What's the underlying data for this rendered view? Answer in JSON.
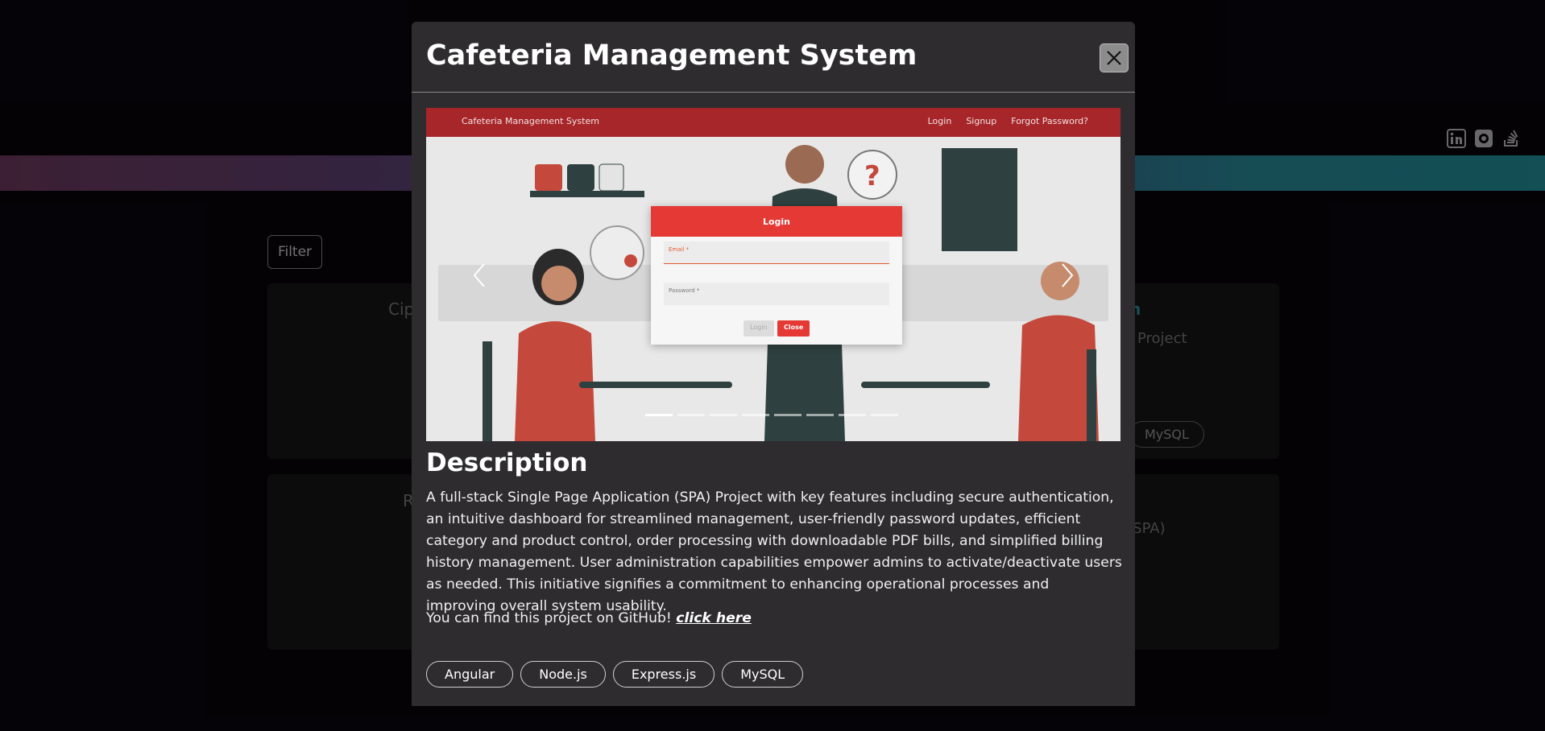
{
  "background": {
    "filter_label": "Filter",
    "card1_left_text": "Cip",
    "card1_right_title": "em",
    "card1_right_sub": "Project",
    "card1_tag": "MySQL",
    "card2_left_text": "R",
    "card2_right_sub": "n (SPA)",
    "social": [
      "linkedin-icon",
      "github-icon",
      "stackoverflow-icon"
    ]
  },
  "modal": {
    "title": "Cafeteria Management System",
    "screenshot": {
      "brand": "Cafeteria Management System",
      "nav": [
        "Login",
        "Signup",
        "Forgot Password?"
      ],
      "dialog_title": "Login",
      "email_placeholder": "Email *",
      "password_placeholder": "Password *",
      "login_btn": "Login",
      "close_btn": "Close",
      "indicator_count": 8,
      "active_indicator": 1
    },
    "description_heading": "Description",
    "description": "A full-stack Single Page Application (SPA) Project with key features including secure authentication, an intuitive dashboard for streamlined management, user-friendly password updates, efficient category and product control, order processing with downloadable PDF bills, and simplified billing history management. User administration capabilities empower admins to activate/deactivate users as needed. This initiative signifies a commitment to enhancing operational processes and improving overall system usability.",
    "github_prefix": "You can find this project on GitHub!",
    "github_link": "click here",
    "tags": [
      "Angular",
      "Node.js",
      "Express.js",
      "MySQL"
    ]
  },
  "colors": {
    "modal_bg": "#2e2c2f",
    "header_red": "#a6262a",
    "accent_red": "#e53935"
  }
}
